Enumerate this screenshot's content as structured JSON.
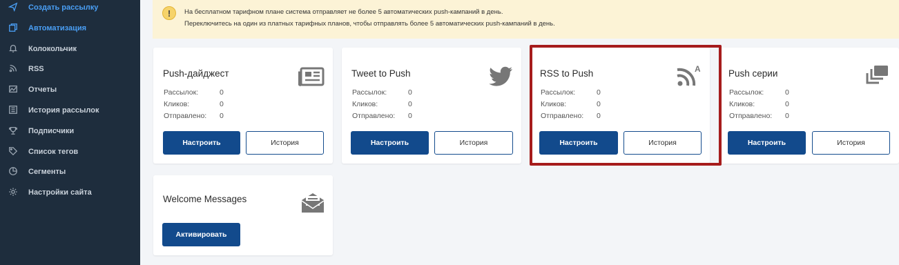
{
  "sidebar": {
    "items": [
      {
        "label": "Создать рассылку",
        "icon": "send-icon",
        "state": "hl"
      },
      {
        "label": "Автоматизация",
        "icon": "automation-icon",
        "state": "active"
      },
      {
        "label": "Колокольчик",
        "icon": "bell-icon",
        "state": ""
      },
      {
        "label": "RSS",
        "icon": "rss-icon",
        "state": ""
      },
      {
        "label": "Отчеты",
        "icon": "reports-icon",
        "state": ""
      },
      {
        "label": "История рассылок",
        "icon": "history-icon",
        "state": ""
      },
      {
        "label": "Подписчики",
        "icon": "subscribers-icon",
        "state": ""
      },
      {
        "label": "Список тегов",
        "icon": "tag-icon",
        "state": ""
      },
      {
        "label": "Сегменты",
        "icon": "segments-icon",
        "state": ""
      },
      {
        "label": "Настройки сайта",
        "icon": "gear-icon",
        "state": ""
      }
    ]
  },
  "notice": {
    "line1": "На бесплатном тарифном плане система отправляет не более 5 автоматических push-кампаний в день.",
    "line2": "Переключитесь на один из платных тарифных планов, чтобы отправлять более 5 автоматических push-кампаний в день.",
    "icon": "!"
  },
  "stat_labels": {
    "mailings": "Рассылок:",
    "clicks": "Кликов:",
    "sent": "Отправлено:"
  },
  "cards": [
    {
      "title": "Push-дайджест",
      "icon": "newspaper-icon",
      "mailings": "0",
      "clicks": "0",
      "sent": "0",
      "primary": "Настроить",
      "secondary": "История"
    },
    {
      "title": "Tweet to Push",
      "icon": "twitter-icon",
      "mailings": "0",
      "clicks": "0",
      "sent": "0",
      "primary": "Настроить",
      "secondary": "История"
    },
    {
      "title": "RSS to Push",
      "icon": "rss-a-icon",
      "mailings": "0",
      "clicks": "0",
      "sent": "0",
      "primary": "Настроить",
      "secondary": "История"
    },
    {
      "title": "Push серии",
      "icon": "series-icon",
      "mailings": "0",
      "clicks": "0",
      "sent": "0",
      "primary": "Настроить",
      "secondary": "История"
    }
  ],
  "welcome": {
    "title": "Welcome Messages",
    "icon": "envelope-letter-icon",
    "button": "Активировать"
  },
  "colors": {
    "sidebar_bg": "#1e2d3d",
    "accent": "#4a9ff5",
    "primary_button": "#124a8c",
    "highlight_border": "#a61c1c",
    "notice_bg": "#fcf3d6"
  }
}
